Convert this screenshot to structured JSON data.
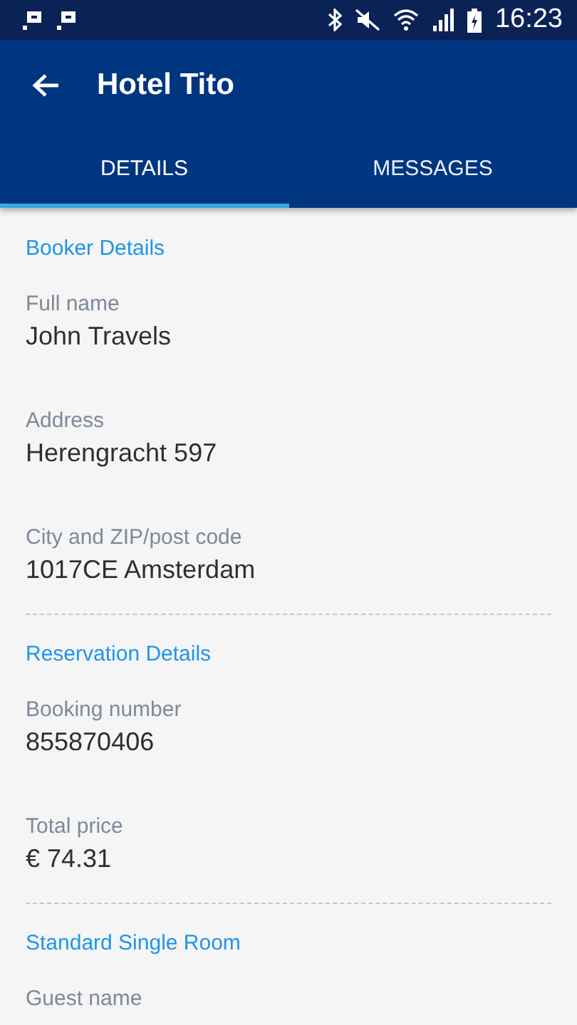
{
  "status_bar": {
    "time": "16:23"
  },
  "app_bar": {
    "title": "Hotel Tito"
  },
  "tabs": [
    {
      "label": "DETAILS",
      "selected": true
    },
    {
      "label": "MESSAGES",
      "selected": false
    }
  ],
  "sections": [
    {
      "title": "Booker Details",
      "fields": [
        {
          "label": "Full name",
          "value": "John Travels"
        },
        {
          "label": "Address",
          "value": "Herengracht 597"
        },
        {
          "label": "City and ZIP/post code",
          "value": "1017CE Amsterdam"
        }
      ]
    },
    {
      "title": "Reservation Details",
      "fields": [
        {
          "label": "Booking number",
          "value": "855870406"
        },
        {
          "label": "Total price",
          "value": "€ 74.31"
        }
      ]
    },
    {
      "title": "Standard Single Room",
      "fields": [
        {
          "label": "Guest name"
        }
      ]
    }
  ]
}
